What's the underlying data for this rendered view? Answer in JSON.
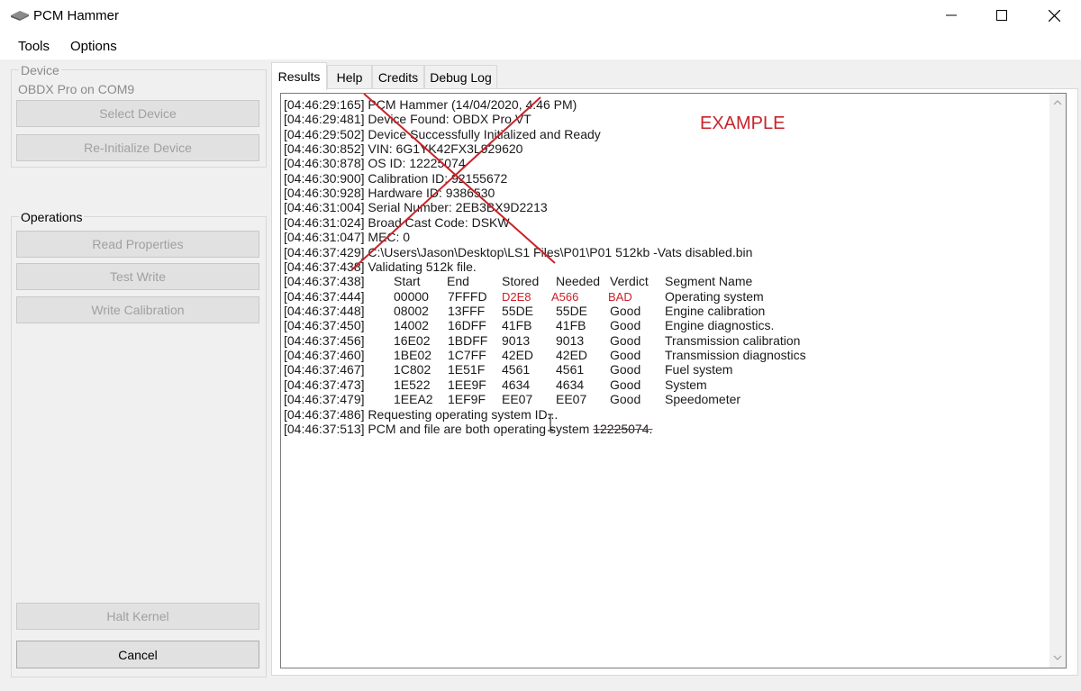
{
  "window": {
    "title": "PCM Hammer",
    "app_icon": "hammer-icon"
  },
  "menu": {
    "tools": "Tools",
    "options": "Options"
  },
  "device": {
    "group_label": "Device",
    "status": "OBDX Pro on COM9",
    "select_button": "Select Device",
    "reinit_button": "Re-Initialize Device"
  },
  "operations": {
    "group_label": "Operations",
    "read_properties": "Read Properties",
    "test_write": "Test Write",
    "write_calibration": "Write Calibration"
  },
  "bottom": {
    "halt_kernel": "Halt Kernel",
    "cancel": "Cancel"
  },
  "tabs": [
    {
      "label": "Results",
      "active": true
    },
    {
      "label": "Help",
      "active": false
    },
    {
      "label": "Credits",
      "active": false
    },
    {
      "label": "Debug Log",
      "active": false
    }
  ],
  "annotation": {
    "example_label": "EXAMPLE",
    "color": "#c8232a"
  },
  "log": {
    "lines": [
      {
        "time": "[04:46:29:165]",
        "text": "PCM Hammer (14/04/2020, 4:46 PM)"
      },
      {
        "time": "[04:46:29:481]",
        "text": "Device Found: OBDX Pro VT"
      },
      {
        "time": "[04:46:29:502]",
        "text": "Device Successfully Initialized and Ready"
      },
      {
        "time": "[04:46:30:852]",
        "text": "VIN: 6G1YK42FX3L929620"
      },
      {
        "time": "[04:46:30:878]",
        "text": "OS ID: 12225074"
      },
      {
        "time": "[04:46:30:900]",
        "text": "Calibration ID: 92155672"
      },
      {
        "time": "[04:46:30:928]",
        "text": "Hardware ID: 9386530"
      },
      {
        "time": "[04:46:31:004]",
        "text": "Serial Number: 2EB3BX9D2213"
      },
      {
        "time": "[04:46:31:024]",
        "text": "Broad Cast Code: DSKW"
      },
      {
        "time": "[04:46:31:047]",
        "text": "MEC: 0"
      },
      {
        "time": "[04:46:37:429]",
        "text": "C:\\Users\\Jason\\Desktop\\LS1 Files\\P01\\P01 512kb -Vats disabled.bin"
      },
      {
        "time": "[04:46:37:438]",
        "text": "Validating 512k file."
      }
    ],
    "segment_header": {
      "time": "[04:46:37:438]",
      "start": "Start",
      "end": "End",
      "stored": "Stored",
      "needed": "Needed",
      "verdict": "Verdict",
      "name": "Segment Name"
    },
    "segments": [
      {
        "time": "[04:46:37:444]",
        "start": "00000",
        "end": "7FFFD",
        "stored": "D2E8",
        "needed": "A566",
        "verdict": "BAD",
        "name": "Operating system"
      },
      {
        "time": "[04:46:37:448]",
        "start": "08002",
        "end": "13FFF",
        "stored": "55DE",
        "needed": "55DE",
        "verdict": "Good",
        "name": "Engine calibration"
      },
      {
        "time": "[04:46:37:450]",
        "start": "14002",
        "end": "16DFF",
        "stored": "41FB",
        "needed": "41FB",
        "verdict": "Good",
        "name": "Engine diagnostics."
      },
      {
        "time": "[04:46:37:456]",
        "start": "16E02",
        "end": "1BDFF",
        "stored": "9013",
        "needed": "9013",
        "verdict": "Good",
        "name": "Transmission calibration"
      },
      {
        "time": "[04:46:37:460]",
        "start": "1BE02",
        "end": "1C7FF",
        "stored": "42ED",
        "needed": "42ED",
        "verdict": "Good",
        "name": "Transmission diagnostics"
      },
      {
        "time": "[04:46:37:467]",
        "start": "1C802",
        "end": "1E51F",
        "stored": "4561",
        "needed": "4561",
        "verdict": "Good",
        "name": "Fuel system"
      },
      {
        "time": "[04:46:37:473]",
        "start": "1E522",
        "end": "1EE9F",
        "stored": "4634",
        "needed": "4634",
        "verdict": "Good",
        "name": "System"
      },
      {
        "time": "[04:46:37:479]",
        "start": "1EEA2",
        "end": "1EF9F",
        "stored": "EE07",
        "needed": "EE07",
        "verdict": "Good",
        "name": "Speedometer"
      }
    ],
    "tail": [
      {
        "time": "[04:46:37:486]",
        "text": "Requesting operating system ID..."
      },
      {
        "time": "[04:46:37:513]",
        "text": "PCM and file are both operating system",
        "struck": "12225074."
      }
    ]
  }
}
